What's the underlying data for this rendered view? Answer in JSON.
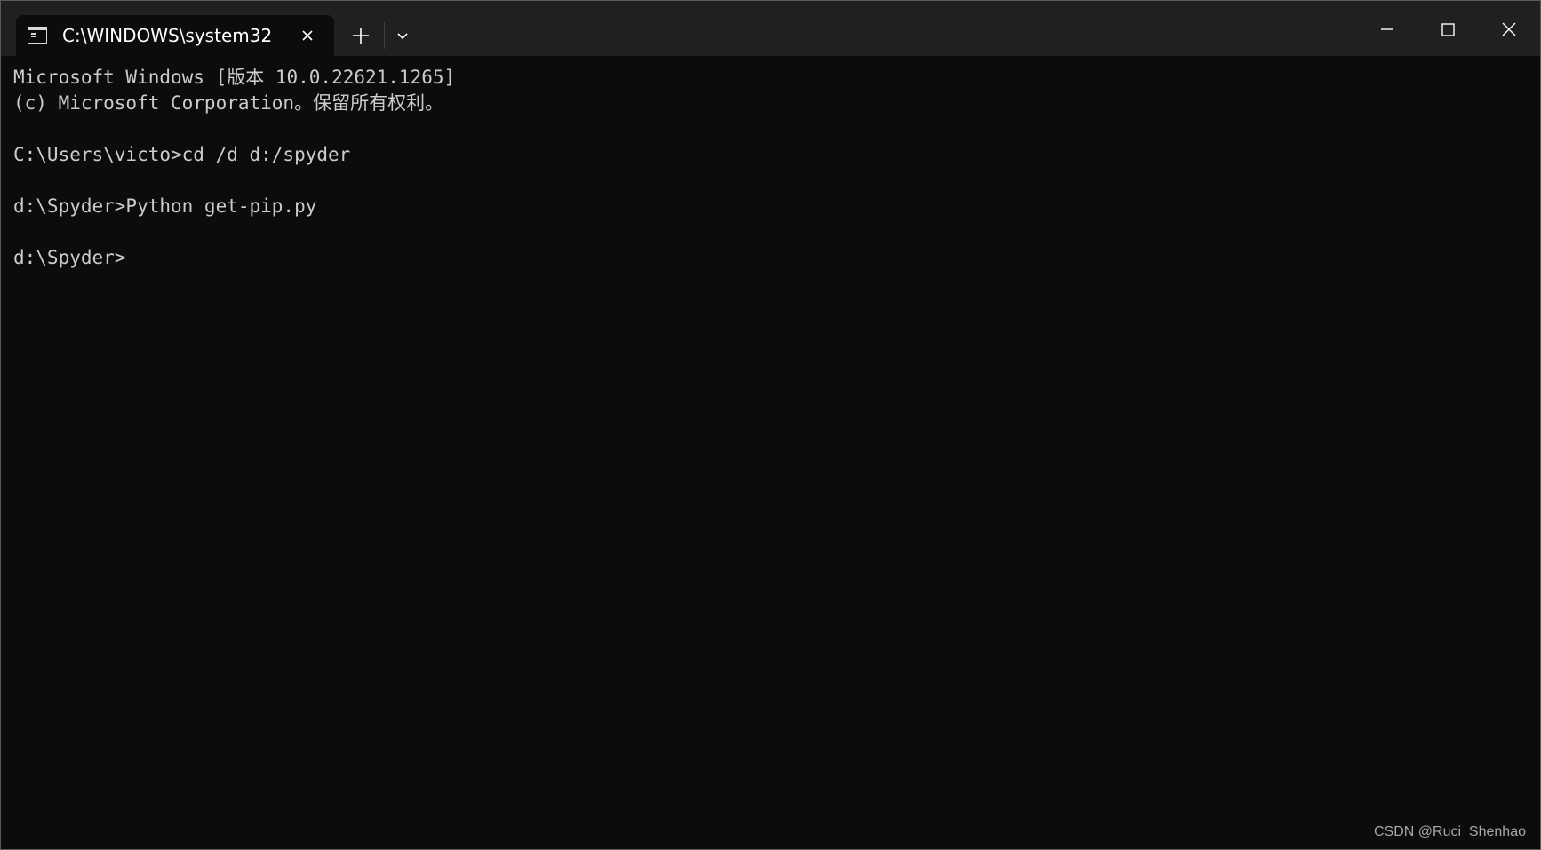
{
  "window": {
    "tab_title": "C:\\WINDOWS\\system32",
    "tab_icon": "terminal-icon",
    "close_tab_icon": "close-icon",
    "new_tab_icon": "plus-icon",
    "dropdown_icon": "chevron-down-icon",
    "controls": [
      "minimize-icon",
      "maximize-icon",
      "close-icon"
    ]
  },
  "terminal": {
    "lines": [
      "Microsoft Windows [版本 10.0.22621.1265]",
      "(c) Microsoft Corporation。保留所有权利。",
      "",
      "C:\\Users\\victo>cd /d d:/spyder",
      "",
      "d:\\Spyder>Python get-pip.py",
      "",
      "d:\\Spyder>"
    ],
    "text_color": "#cccccc",
    "background": "#0c0c0c"
  },
  "watermark": "CSDN @Ruci_Shenhao"
}
